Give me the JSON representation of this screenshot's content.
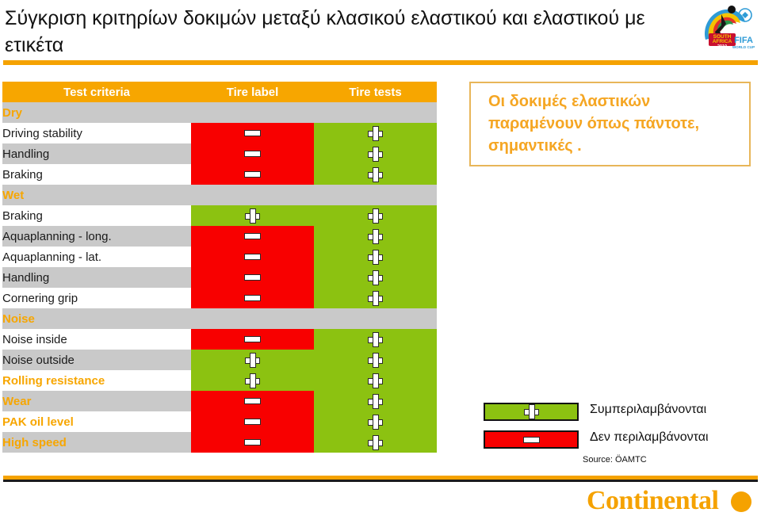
{
  "slide": {
    "title": "Σύγκριση  κριτηρίων δοκιμών μεταξύ κλασικού ελαστικού και ελαστικού με ετικέτα"
  },
  "logos": {
    "fifa": {
      "name": "fifa-world-cup-south-africa-2010-logo",
      "line1": "SOUTH",
      "line2": "AFRICA",
      "line3": "2010",
      "brand": "FIFA",
      "sub": "WORLD CUP"
    },
    "continental": {
      "wordmark": "Continental",
      "color": "#F5A200"
    }
  },
  "table": {
    "headers": [
      "Test criteria",
      "Tire label",
      "Tire tests"
    ],
    "rows": [
      {
        "type": "section",
        "label": "Dry",
        "label_style": "orange",
        "row_bg": "grey"
      },
      {
        "type": "data",
        "label": "Driving stability",
        "label_style": "plain",
        "row_bg": "white",
        "tire_label": "minus",
        "tire_tests": "plus"
      },
      {
        "type": "data",
        "label": "Handling",
        "label_style": "plain",
        "row_bg": "grey",
        "tire_label": "minus",
        "tire_tests": "plus"
      },
      {
        "type": "data",
        "label": "Braking",
        "label_style": "plain",
        "row_bg": "white",
        "tire_label": "minus",
        "tire_tests": "plus"
      },
      {
        "type": "section",
        "label": "Wet",
        "label_style": "orange",
        "row_bg": "grey"
      },
      {
        "type": "data",
        "label": "Braking",
        "label_style": "plain",
        "row_bg": "white",
        "tire_label": "plus",
        "tire_tests": "plus"
      },
      {
        "type": "data",
        "label": "Aquaplanning - long.",
        "label_style": "plain",
        "row_bg": "grey",
        "tire_label": "minus",
        "tire_tests": "plus"
      },
      {
        "type": "data",
        "label": "Aquaplanning - lat.",
        "label_style": "plain",
        "row_bg": "white",
        "tire_label": "minus",
        "tire_tests": "plus"
      },
      {
        "type": "data",
        "label": "Handling",
        "label_style": "plain",
        "row_bg": "grey",
        "tire_label": "minus",
        "tire_tests": "plus"
      },
      {
        "type": "data",
        "label": "Cornering grip",
        "label_style": "plain",
        "row_bg": "white",
        "tire_label": "minus",
        "tire_tests": "plus"
      },
      {
        "type": "section",
        "label": "Noise",
        "label_style": "orange",
        "row_bg": "grey"
      },
      {
        "type": "data",
        "label": "Noise inside",
        "label_style": "plain",
        "row_bg": "white",
        "tire_label": "minus",
        "tire_tests": "plus"
      },
      {
        "type": "data",
        "label": "Noise outside",
        "label_style": "plain",
        "row_bg": "grey",
        "tire_label": "plus",
        "tire_tests": "plus"
      },
      {
        "type": "data",
        "label": "Rolling resistance",
        "label_style": "orange",
        "row_bg": "white",
        "tire_label": "plus",
        "tire_tests": "plus"
      },
      {
        "type": "data",
        "label": "Wear",
        "label_style": "orange",
        "row_bg": "grey",
        "tire_label": "minus",
        "tire_tests": "plus"
      },
      {
        "type": "data",
        "label": "PAK oil level",
        "label_style": "orange",
        "row_bg": "white",
        "tire_label": "minus",
        "tire_tests": "plus"
      },
      {
        "type": "data",
        "label": "High speed",
        "label_style": "orange",
        "row_bg": "grey",
        "tire_label": "minus",
        "tire_tests": "plus"
      }
    ]
  },
  "callout": {
    "text": "Οι δοκιμές ελαστικών παραμένουν όπως πάντοτε, σημαντικές ."
  },
  "legend": {
    "items": [
      {
        "mark": "plus",
        "label": "Συμπεριλαμβάνονται"
      },
      {
        "mark": "minus",
        "label": "Δεν περιλαμβάνονται"
      }
    ],
    "source": "Source: ÖAMTC"
  },
  "colors": {
    "accent_orange": "#F5A200",
    "header_orange": "#F7A600",
    "positive_green": "#8CC211",
    "negative_red": "#F80000",
    "row_grey": "#C9C9C9",
    "row_white": "#FFFFFF"
  }
}
